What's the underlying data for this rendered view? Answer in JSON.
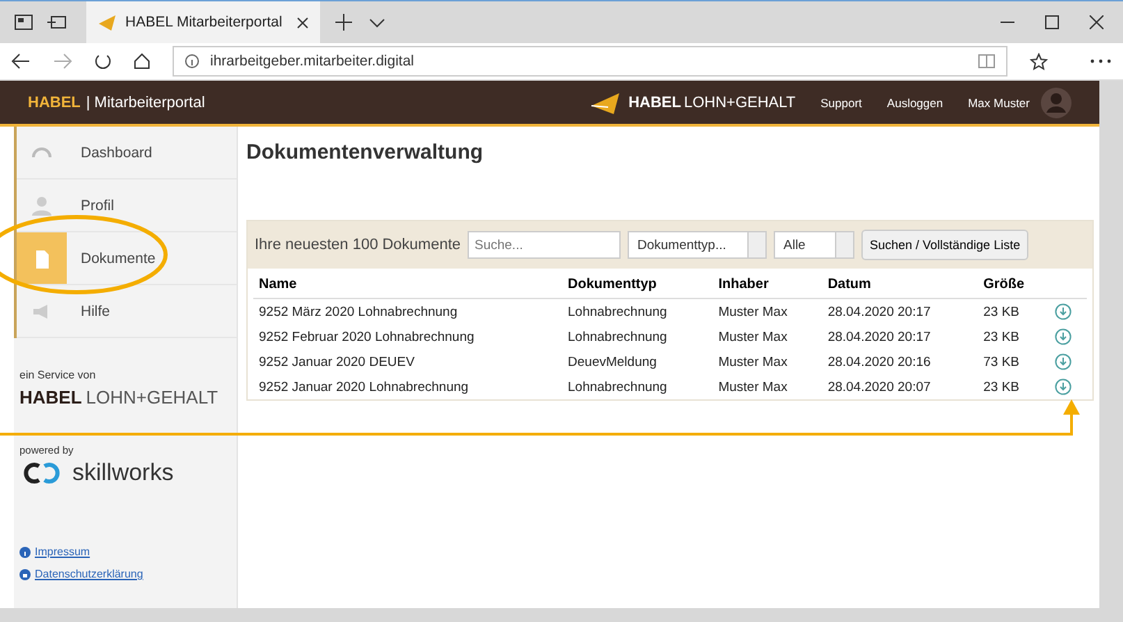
{
  "browser": {
    "tab_title": "HABEL Mitarbeiterportal",
    "url": "ihrarbeitgeber.mitarbeiter.digital"
  },
  "header": {
    "brand_highlight": "HABEL",
    "brand_rest": "| Mitarbeiterportal",
    "logo_bold": "HABEL",
    "logo_light": "LOHN+GEHALT",
    "links": [
      "Support",
      "Ausloggen"
    ],
    "user": "Max Muster"
  },
  "sidebar": {
    "items": [
      {
        "label": "Dashboard",
        "kind": "dashboard",
        "selected": false
      },
      {
        "label": "Profil",
        "kind": "profile",
        "selected": false
      },
      {
        "label": "Dokumente",
        "kind": "document",
        "selected": true
      },
      {
        "label": "Hilfe",
        "kind": "help",
        "selected": false
      }
    ],
    "service_label": "ein Service von",
    "service_logo_bold": "HABEL",
    "service_logo_light": "LOHN+GEHALT",
    "powered_label": "powered by",
    "powered_logo": "skillworks",
    "links": [
      {
        "label": "Impressum",
        "kind": "info"
      },
      {
        "label": "Datenschutzerklärung",
        "kind": "privacy"
      }
    ]
  },
  "content": {
    "title": "Dokumentenverwaltung",
    "panel_label": "Ihre neuesten 100 Dokumente",
    "search": {
      "placeholder": "Suche..."
    },
    "type_select": "Dokumenttyp...",
    "owner_select": "Alle",
    "search_button": "Suchen / Vollständige Liste",
    "table": {
      "columns": [
        "Name",
        "Dokumenttyp",
        "Inhaber",
        "Datum",
        "Größe"
      ],
      "rows": [
        [
          "9252 März 2020 Lohnabrechnung",
          "Lohnabrechnung",
          "Muster Max",
          "28.04.2020 20:17",
          "23 KB"
        ],
        [
          "9252 Februar 2020 Lohnabrechnung",
          "Lohnabrechnung",
          "Muster Max",
          "28.04.2020 20:17",
          "23 KB"
        ],
        [
          "9252 Januar 2020 DEUEV",
          "DeuevMeldung",
          "Muster Max",
          "28.04.2020 20:16",
          "73 KB"
        ],
        [
          "9252 Januar 2020 Lohnabrechnung",
          "Lohnabrechnung",
          "Muster Max",
          "28.04.2020 20:07",
          "23 KB"
        ]
      ]
    }
  }
}
